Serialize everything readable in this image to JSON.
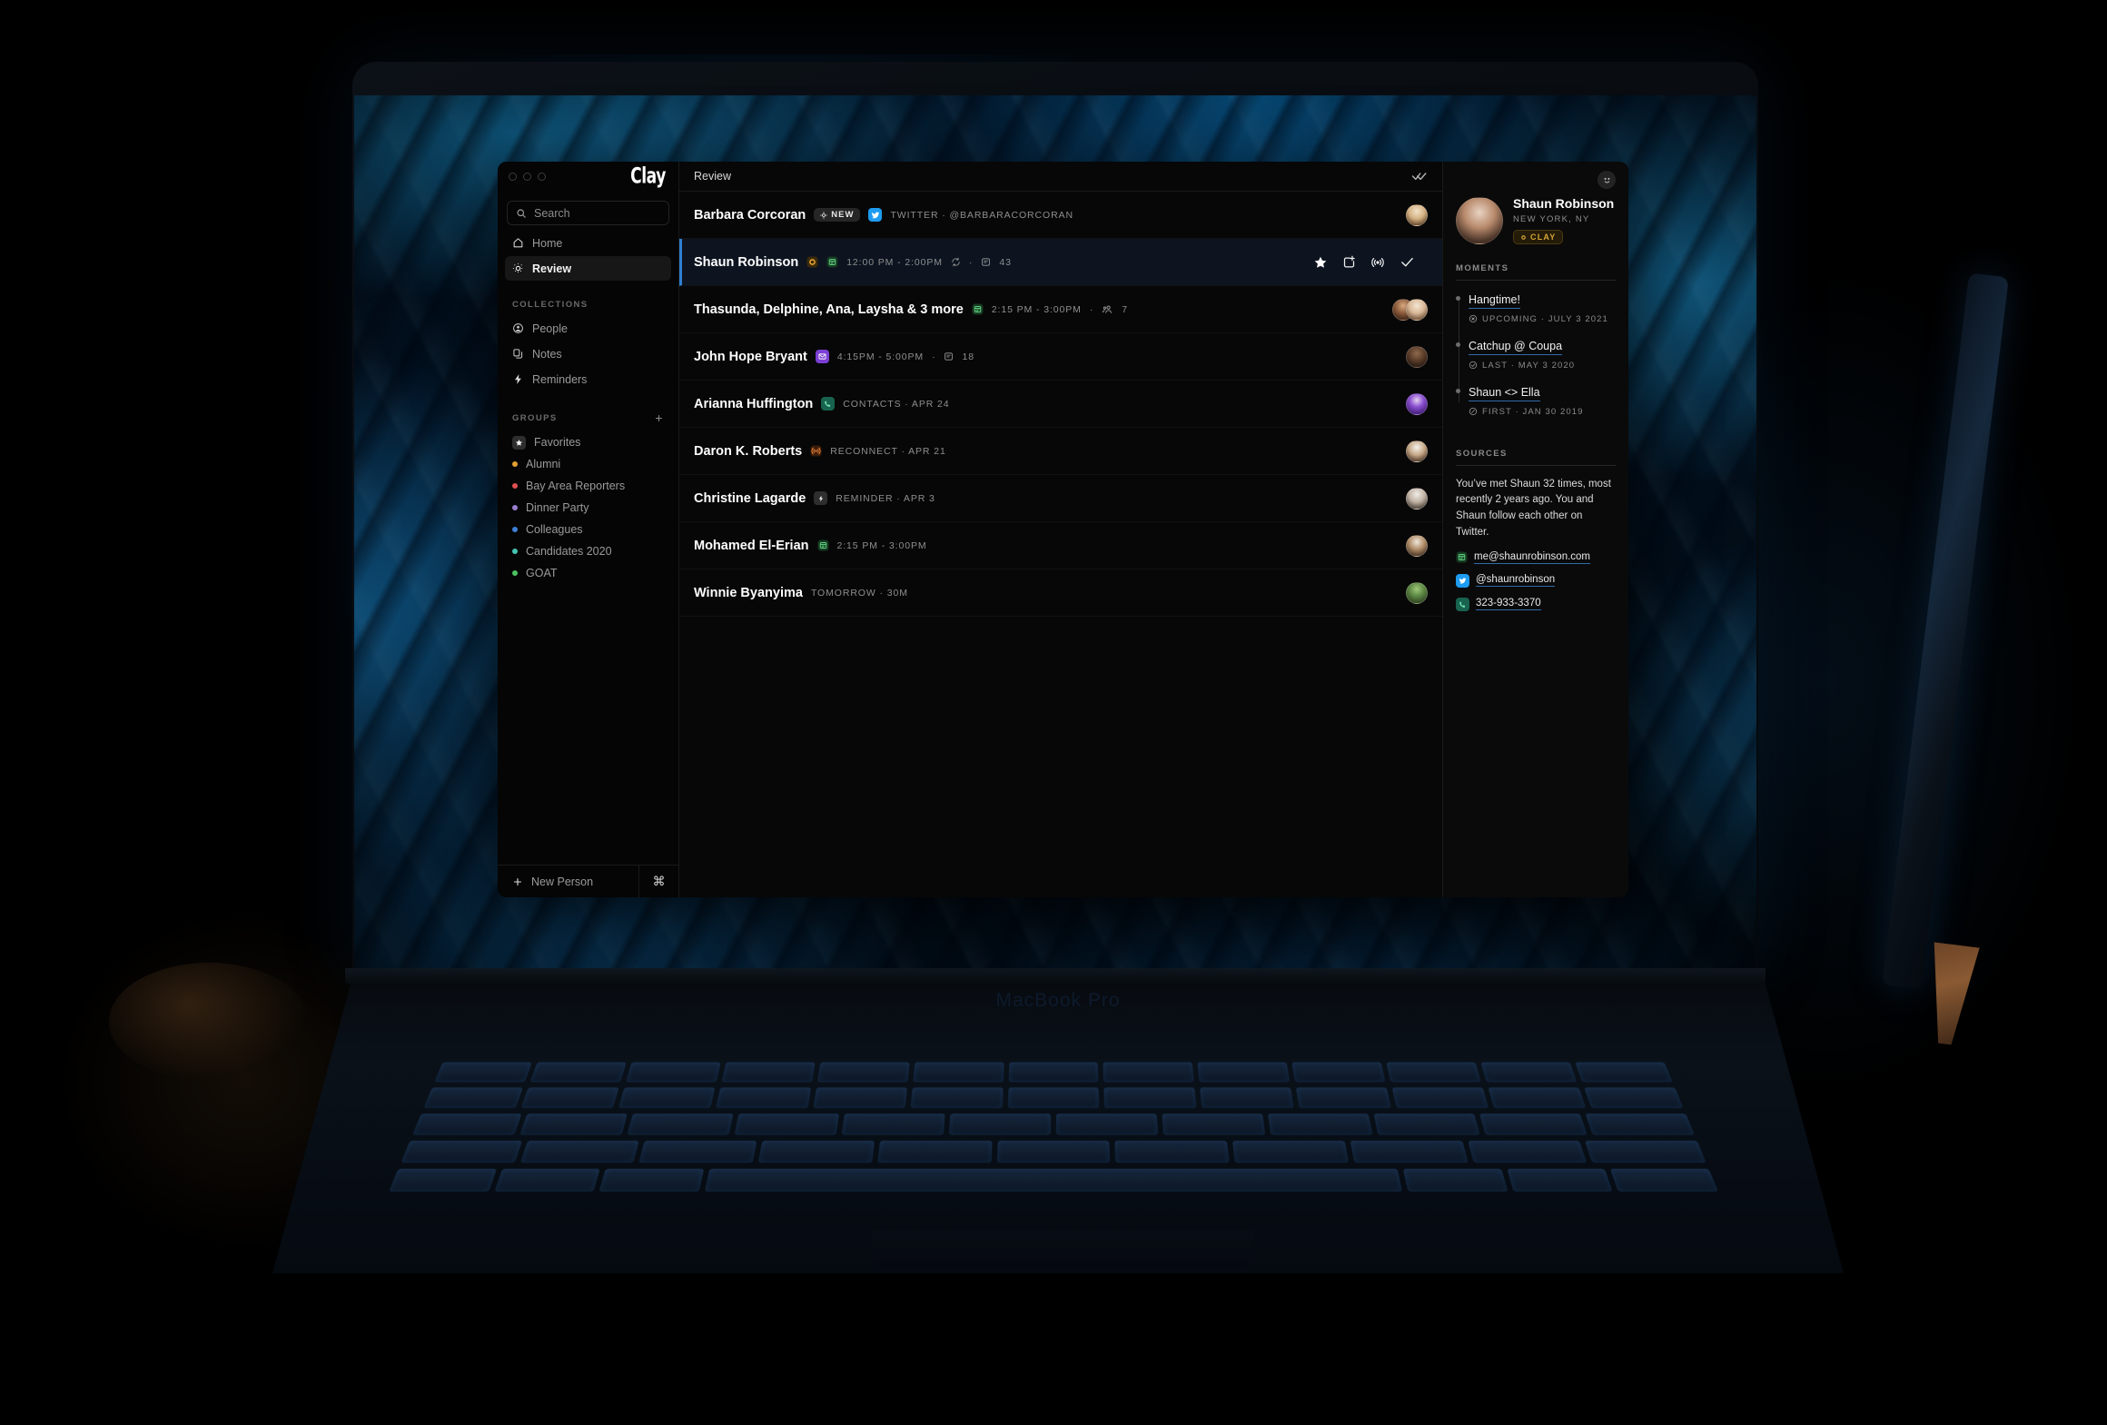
{
  "device": {
    "label": "MacBook Pro"
  },
  "window": {
    "brand": "Clay",
    "traffic_lights": [
      "close",
      "minimize",
      "zoom"
    ]
  },
  "sidebar": {
    "search": {
      "placeholder": "Search",
      "value": ""
    },
    "nav": [
      {
        "label": "Home",
        "icon": "home-icon",
        "active": false
      },
      {
        "label": "Review",
        "icon": "sun-icon",
        "active": true
      }
    ],
    "collections_header": "COLLECTIONS",
    "collections": [
      {
        "label": "People",
        "icon": "person-circle-icon"
      },
      {
        "label": "Notes",
        "icon": "notes-icon"
      },
      {
        "label": "Reminders",
        "icon": "bolt-icon"
      }
    ],
    "groups_header": "GROUPS",
    "groups_add": "+",
    "groups": [
      {
        "label": "Favorites",
        "icon": "star-icon",
        "color": "#2e2e2e"
      },
      {
        "label": "Alumni",
        "color": "#e0a030"
      },
      {
        "label": "Bay Area Reporters",
        "color": "#e05050"
      },
      {
        "label": "Dinner Party",
        "color": "#9a7fd0"
      },
      {
        "label": "Colleagues",
        "color": "#3e7fd8"
      },
      {
        "label": "Candidates 2020",
        "color": "#46c4b4"
      },
      {
        "label": "GOAT",
        "color": "#4cc262"
      }
    ],
    "footer": {
      "new_person": "New Person",
      "shortcut": "⌘"
    }
  },
  "main": {
    "title": "Review",
    "done_icon": "double-check-icon",
    "rows": [
      {
        "name": "Barbara Corcoran",
        "badge": "NEW",
        "source_icon": "twitter-icon",
        "source_color": "#1d9bf0",
        "meta": "TWITTER · @BARBARACORCORAN",
        "avatar": "barbara-avatar",
        "selected": false
      },
      {
        "name": "Shaun Robinson",
        "icons": [
          "clay-ring-icon",
          "calendar-icon"
        ],
        "meta": "12:00 PM - 2:00PM",
        "meta2": "43",
        "selected": true,
        "actions": [
          "star-icon",
          "add-to-group-icon",
          "reconnect-icon",
          "check-icon"
        ]
      },
      {
        "name": "Thasunda, Delphine, Ana, Laysha & 3 more",
        "icons": [
          "calendar-icon"
        ],
        "meta": "2:15 PM - 3:00PM",
        "meta2": "7",
        "avatar": "group-avatars",
        "selected": false
      },
      {
        "name": "John Hope Bryant",
        "icons": [
          "email-icon"
        ],
        "meta": "4:15PM - 5:00PM",
        "meta2": "18",
        "avatar": "john-avatar",
        "selected": false
      },
      {
        "name": "Arianna Huffington",
        "icons": [
          "phone-icon"
        ],
        "meta": "CONTACTS · APR 24",
        "avatar": "arianna-avatar",
        "selected": false
      },
      {
        "name": "Daron K. Roberts",
        "icons": [
          "reconnect-orange-icon"
        ],
        "meta": "RECONNECT · APR 21",
        "avatar": "daron-avatar",
        "selected": false
      },
      {
        "name": "Christine Lagarde",
        "icons": [
          "bolt-chip-icon"
        ],
        "meta": "REMINDER · APR 3",
        "avatar": "christine-avatar",
        "selected": false
      },
      {
        "name": "Mohamed El-Erian",
        "icons": [
          "calendar-icon"
        ],
        "meta": "2:15 PM - 3:00PM",
        "avatar": "mohamed-avatar",
        "selected": false
      },
      {
        "name": "Winnie Byanyima",
        "icons": [],
        "meta": "TOMORROW · 30M",
        "avatar": "winnie-avatar",
        "selected": false
      }
    ]
  },
  "detail": {
    "smiley_icon": "smiley-icon",
    "name": "Shaun Robinson",
    "location": "NEW YORK, NY",
    "chip": "CLAY",
    "chip_color": "#d6a435",
    "moments_header": "MOMENTS",
    "moments": [
      {
        "title": "Hangtime!",
        "status_icon": "x-circle-icon",
        "sub": "UPCOMING · JULY 3 2021"
      },
      {
        "title": "Catchup @ Coupa",
        "status_icon": "check-circle-icon",
        "sub": "LAST · MAY 3 2020"
      },
      {
        "title": "Shaun <> Ella",
        "status_icon": "slash-circle-icon",
        "sub": "FIRST · JAN 30 2019"
      }
    ],
    "sources_header": "SOURCES",
    "summary": "You’ve met Shaun 32 times, most recently 2 years ago. You and Shaun follow each other on Twitter.",
    "links": [
      {
        "icon": "calendar-icon",
        "text": "me@shaunrobinson.com"
      },
      {
        "icon": "twitter-icon",
        "text": "@shaunrobinson"
      },
      {
        "icon": "phone-icon",
        "text": "323-933-3370"
      }
    ]
  }
}
